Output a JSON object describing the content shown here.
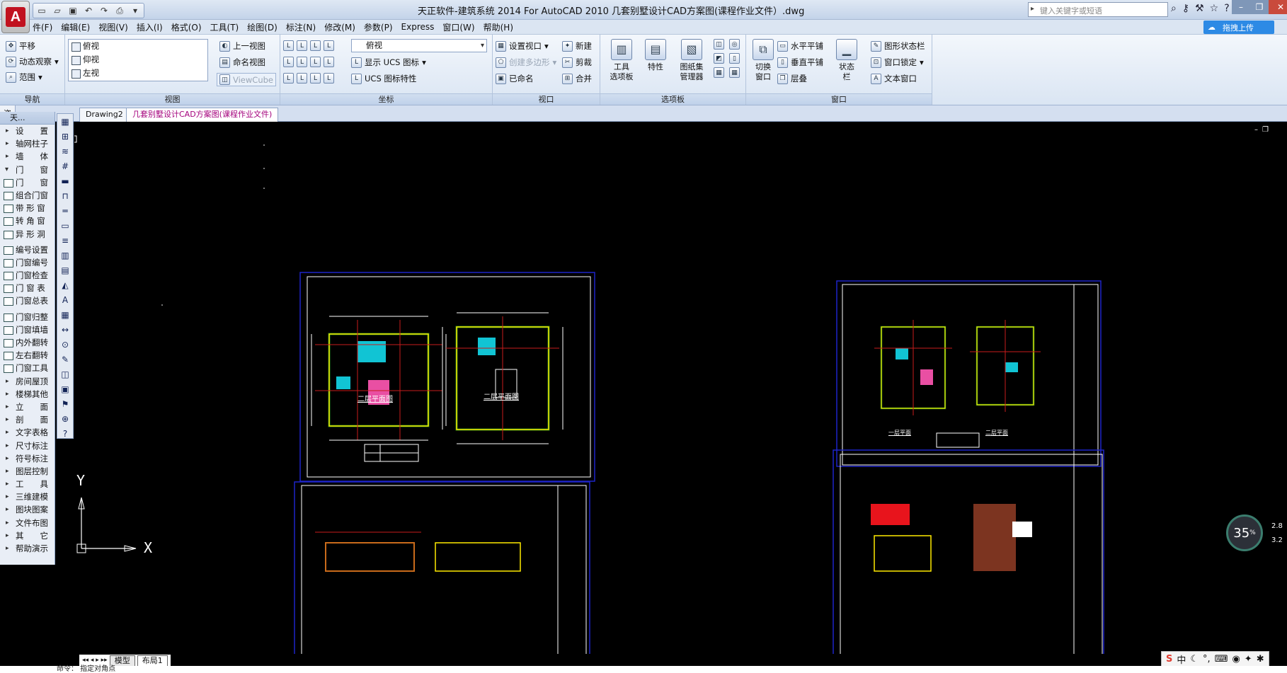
{
  "title_bar": {
    "window_title": "天正软件-建筑系统 2014  For AutoCAD 2010        几套别墅设计CAD方案图(课程作业文件）.dwg",
    "search_placeholder": "键入关键字或短语",
    "app_letter": "A"
  },
  "menu": {
    "items": [
      "件(F)",
      "编辑(E)",
      "视图(V)",
      "插入(I)",
      "格式(O)",
      "工具(T)",
      "绘图(D)",
      "标注(N)",
      "修改(M)",
      "参数(P)",
      "Express",
      "窗口(W)",
      "帮助(H)"
    ],
    "upload_label": "拖拽上传"
  },
  "ribbon": {
    "nav": {
      "pan": "平移",
      "orbit": "动态观察",
      "extents": "范围",
      "title": "导航"
    },
    "view": {
      "list": [
        "俯视",
        "仰视",
        "左视"
      ],
      "prev_view": "上一视图",
      "named_view": "命名视图",
      "viewcube": "ViewCube",
      "title": "视图"
    },
    "coords": {
      "combo": "俯视",
      "ucs_icon": "显示 UCS 图标",
      "ucs_props": "UCS 图标特性",
      "title": "坐标"
    },
    "viewport": {
      "set": "设置视口",
      "poly": "创建多边形",
      "named": "已命名",
      "new": "新建",
      "clip": "剪裁",
      "join": "合并",
      "title": "视口"
    },
    "palettes": {
      "tool": "工具\n选项板",
      "props": "特性",
      "sheetset": "图纸集\n管理器",
      "title": "选项板"
    },
    "window": {
      "switch": "切换\n窗口",
      "tile_h": "水平平铺",
      "tile_v": "垂直平铺",
      "cascade": "层叠",
      "status": "状态\n栏",
      "layout_status": "图形状态栏",
      "lock": "窗口锁定",
      "text_win": "文本窗口",
      "title": "窗口"
    }
  },
  "tabs": {
    "side_tab": "资讯",
    "docs": [
      "Drawing2",
      "几套别墅设计CAD方案图(课程作业文件)"
    ]
  },
  "palette": {
    "title": "天...",
    "items": [
      "设　　置",
      "轴网柱子",
      "墙　　体",
      "门　　窗",
      "门　　窗",
      "组合门窗",
      "带 形 窗",
      "转 角 窗",
      "异 形 洞",
      "编号设置",
      "门窗编号",
      "门窗检查",
      "门 窗 表",
      "门窗总表",
      "门窗归整",
      "门窗填墙",
      "内外翻转",
      "左右翻转",
      "门窗工具",
      "房间屋顶",
      "楼梯其他",
      "立　　面",
      "剖　　面",
      "文字表格",
      "尺寸标注",
      "符号标注",
      "图层控制",
      "工　　具",
      "三维建模",
      "图块图案",
      "文件布图",
      "其　　它",
      "帮助演示"
    ]
  },
  "drawing": {
    "labels": [
      "二层平面图",
      "二层平面图",
      "一层平面",
      "二层平面"
    ],
    "table_text": "",
    "ucs_x": "X",
    "ucs_y": "Y"
  },
  "bottom": {
    "layout_tabs": [
      "模型",
      "布局1"
    ],
    "command": "命令：  指定对角点"
  },
  "overlay": {
    "percent": "35",
    "percent_unit": "%",
    "side_values": [
      "2.8",
      "3.2"
    ]
  },
  "colors": {
    "canvas": "#000000",
    "sheet_border": "#1e24c8",
    "ribbon_bg": "#dae5f3",
    "upload": "#2d8ae5"
  }
}
